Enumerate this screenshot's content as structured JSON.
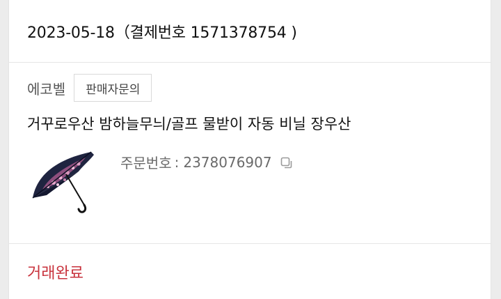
{
  "order": {
    "date": "2023-05-18",
    "payment_label": "결제번호",
    "payment_number": "1571378754",
    "header_text": "2023-05-18（결제번호 1571378754 )"
  },
  "seller": {
    "name": "에코벨",
    "contact_label": "판매자문의"
  },
  "product": {
    "name": "거꾸로우산 밤하늘무늬/골프 물받이 자동 비닐 장우산",
    "image_icon": "umbrella-image"
  },
  "order_info": {
    "label": "주문번호",
    "separator": ":",
    "number": "2378076907",
    "copy_icon": "copy-icon"
  },
  "status": {
    "text": "거래완료",
    "color": "#c8323c"
  }
}
